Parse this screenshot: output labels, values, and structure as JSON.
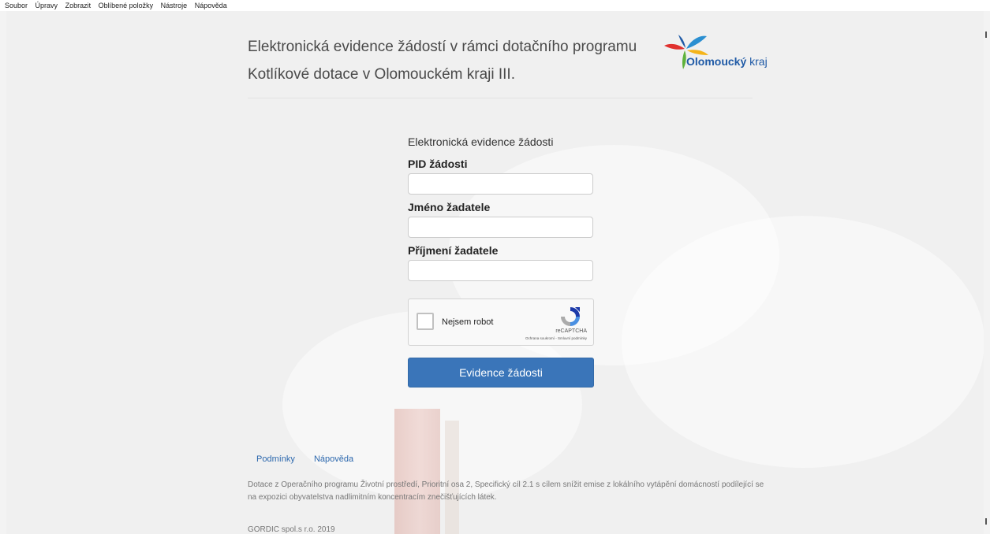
{
  "menu": [
    "Soubor",
    "Úpravy",
    "Zobrazit",
    "Oblíbené položky",
    "Nástroje",
    "Nápověda"
  ],
  "header": {
    "title_line1": "Elektronická evidence žádostí v rámci dotačního programu",
    "title_line2": "Kotlíkové dotace v Olomouckém kraji III.",
    "logo_bold": "Olomoucký",
    "logo_light": "kraj"
  },
  "form": {
    "caption": "Elektronická evidence žádosti",
    "pid_label": "PID žádosti",
    "pid_value": "",
    "first_name_label": "Jméno žadatele",
    "first_name_value": "",
    "last_name_label": "Příjmení žadatele",
    "last_name_value": "",
    "submit_label": "Evidence žádosti"
  },
  "recaptcha": {
    "label": "Nejsem robot",
    "brand": "reCAPTCHA",
    "terms": "Ochrana soukromí - Smluvní podmínky"
  },
  "footer": {
    "link_terms": "Podmínky",
    "link_help": "Nápověda",
    "text": "Dotace z Operačního programu Životní prostředí, Prioritní osa 2, Specifický cíl 2.1 s cílem snížit emise z lokálního vytápění domácností podílející se na expozici obyvatelstva nadlimitním koncentracím znečišťujících látek.",
    "copyright": "GORDIC spol.s r.o. 2019"
  },
  "colors": {
    "accent": "#3a75b9",
    "link": "#2b67ad",
    "logo_blue": "#1f5aa6"
  }
}
